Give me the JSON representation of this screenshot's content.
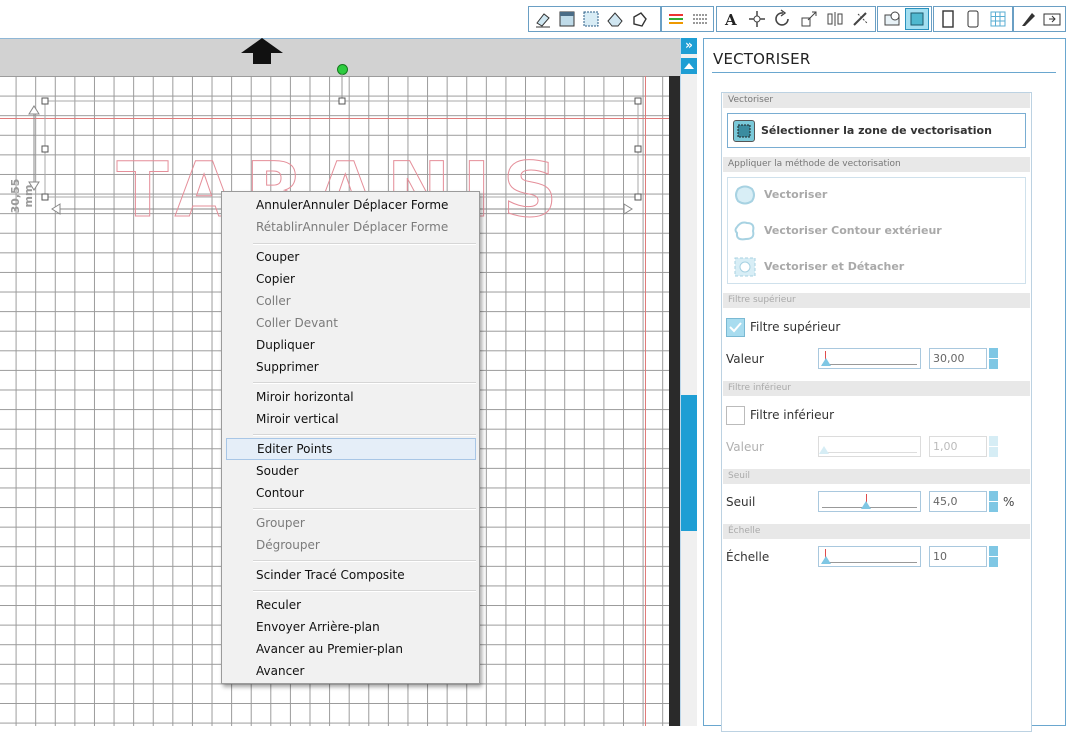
{
  "toolbar": {
    "icons": [
      "eraser-icon",
      "fill-icon",
      "pattern-icon",
      "shape-fill-icon",
      "polygon-icon",
      "line-color-icon",
      "line-style-icon",
      "text-icon",
      "move-icon",
      "rotate-icon",
      "scale-icon",
      "align-icon",
      "replicate-icon",
      "trace-window-icon",
      "trace-active-icon",
      "page-icon",
      "page-alt-icon",
      "grid-icon",
      "knife-icon",
      "send-icon"
    ]
  },
  "canvas": {
    "dimension_label": "30,55 mm",
    "design_text": "TARANIS"
  },
  "context_menu": {
    "items": [
      {
        "label": "AnnulerAnnuler Déplacer Forme",
        "enabled": true
      },
      {
        "label": "RétablirAnnuler Déplacer Forme",
        "enabled": false
      },
      {
        "label": "Couper",
        "enabled": true
      },
      {
        "label": "Copier",
        "enabled": true
      },
      {
        "label": "Coller",
        "enabled": false
      },
      {
        "label": "Coller Devant",
        "enabled": false
      },
      {
        "label": "Dupliquer",
        "enabled": true
      },
      {
        "label": "Supprimer",
        "enabled": true
      },
      {
        "label": "Miroir horizontal",
        "enabled": true
      },
      {
        "label": "Miroir vertical",
        "enabled": true
      },
      {
        "label": "Editer Points",
        "enabled": true,
        "hovered": true
      },
      {
        "label": "Souder",
        "enabled": true
      },
      {
        "label": "Contour",
        "enabled": true
      },
      {
        "label": "Grouper",
        "enabled": false
      },
      {
        "label": "Dégrouper",
        "enabled": false
      },
      {
        "label": "Scinder Tracé Composite",
        "enabled": true
      },
      {
        "label": "Reculer",
        "enabled": true
      },
      {
        "label": "Envoyer Arrière-plan",
        "enabled": true
      },
      {
        "label": "Avancer au Premier-plan",
        "enabled": true
      },
      {
        "label": "Avancer",
        "enabled": true
      }
    ]
  },
  "scrollbar": {
    "collapse_glyph": "»"
  },
  "panel": {
    "title": "VECTORISER",
    "section_vectoriser": "Vectoriser",
    "select_area_button": "Sélectionner la zone de vectorisation",
    "section_method": "Appliquer la méthode de vectorisation",
    "methods": [
      "Vectoriser",
      "Vectoriser Contour extérieur",
      "Vectoriser et Détacher"
    ],
    "section_high_filter": "Filtre supérieur",
    "high_filter_checkbox": "Filtre supérieur",
    "high_filter_checked": true,
    "value_label": "Valeur",
    "high_filter_value": "30,00",
    "section_low_filter": "Filtre inférieur",
    "low_filter_checkbox": "Filtre inférieur",
    "low_filter_checked": false,
    "low_value_label": "Valeur",
    "low_filter_value": "1,00",
    "section_threshold": "Seuil",
    "threshold_label": "Seuil",
    "threshold_value": "45,0",
    "threshold_unit": "%",
    "section_scale": "Échelle",
    "scale_label": "Échelle",
    "scale_value": "10"
  }
}
